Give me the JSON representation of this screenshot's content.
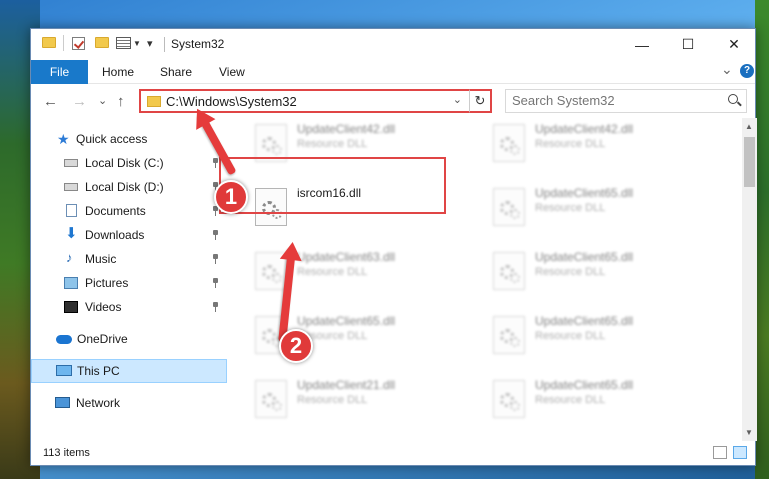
{
  "window": {
    "title": "System32",
    "controls": {
      "minimize": "—",
      "maximize": "☐",
      "close": "✕"
    }
  },
  "ribbon": {
    "tabs": [
      "File",
      "Home",
      "Share",
      "View"
    ],
    "expand_glyph": "⌄",
    "help_glyph": "?"
  },
  "navigation": {
    "back": "←",
    "forward": "→",
    "recent": "⌄",
    "up": "↑",
    "address": "C:\\Windows\\System32",
    "address_chevron": "⌄",
    "refresh": "↻",
    "search_placeholder": "Search System32"
  },
  "sidebar": {
    "items": [
      {
        "label": "Quick access",
        "icon": "star-icon",
        "pinned": false
      },
      {
        "label": "Local Disk (C:)",
        "icon": "disk-icon",
        "pinned": true
      },
      {
        "label": "Local Disk (D:)",
        "icon": "disk-icon",
        "pinned": true
      },
      {
        "label": "Documents",
        "icon": "documents-icon",
        "pinned": true
      },
      {
        "label": "Downloads",
        "icon": "download-icon",
        "pinned": true
      },
      {
        "label": "Music",
        "icon": "music-icon",
        "pinned": true
      },
      {
        "label": "Pictures",
        "icon": "pictures-icon",
        "pinned": true
      },
      {
        "label": "Videos",
        "icon": "videos-icon",
        "pinned": true
      },
      {
        "label": "OneDrive",
        "icon": "onedrive-icon",
        "pinned": false
      },
      {
        "label": "This PC",
        "icon": "pc-icon",
        "pinned": false,
        "selected": true
      },
      {
        "label": "Network",
        "icon": "network-icon",
        "pinned": false
      }
    ]
  },
  "files": [
    {
      "name": "UpdateClient42.dll",
      "type": "Resource DLL",
      "blurred": true
    },
    {
      "name": "UpdateClient42.dll",
      "type": "Resource DLL",
      "blurred": true
    },
    {
      "name": "isrcom16.dll",
      "type": "",
      "blurred": false,
      "highlighted": true
    },
    {
      "name": "UpdateClient65.dll",
      "type": "Resource DLL",
      "blurred": true
    },
    {
      "name": "UpdateClient63.dll",
      "type": "Resource DLL",
      "blurred": true
    },
    {
      "name": "UpdateClient65.dll",
      "type": "Resource DLL",
      "blurred": true
    },
    {
      "name": "UpdateClient65.dll",
      "type": "Resource DLL",
      "blurred": true
    },
    {
      "name": "UpdateClient65.dll",
      "type": "Resource DLL",
      "blurred": true
    },
    {
      "name": "UpdateClient21.dll",
      "type": "Resource DLL",
      "blurred": true
    },
    {
      "name": "UpdateClient65.dll",
      "type": "Resource DLL",
      "blurred": true
    }
  ],
  "status": {
    "item_count": "113 items"
  },
  "annotations": {
    "steps": [
      "1",
      "2"
    ],
    "highlight_color": "#e04545"
  },
  "colors": {
    "accent": "#1979ca",
    "selection": "#cce8ff",
    "annotation": "#e53b3b"
  }
}
